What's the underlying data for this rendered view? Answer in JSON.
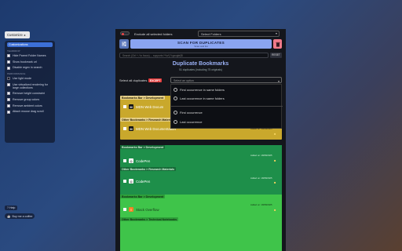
{
  "sidebar": {
    "customize_label": "Customize",
    "active_item": "Customizations",
    "sections": [
      {
        "title": "",
        "items": [
          {
            "label": "Hide Parent Folder Names",
            "checked": false
          },
          {
            "label": "Show bookmark url",
            "checked": false
          },
          {
            "label": "Disable regex in search",
            "checked": false
          }
        ]
      },
      {
        "title": "PERFORMANCE",
        "items": [
          {
            "label": "Use light mode",
            "checked": true
          },
          {
            "label": "Use virtualized rendering for large collections",
            "checked": false
          },
          {
            "label": "Remove height constraint",
            "checked": false
          },
          {
            "label": "Remove group colors",
            "checked": false
          },
          {
            "label": "Remove ambient colors",
            "checked": false
          },
          {
            "label": "Attach mouse drag scroll",
            "checked": false
          }
        ]
      }
    ],
    "section_title_1": "TEARDROP",
    "help_label": "? Help",
    "coffee_label": "Buy me a coffee"
  },
  "topbar": {
    "exclude_label": "Exclude all selected folders",
    "folder_placeholder": "Select Folders"
  },
  "scan": {
    "title": "SCAN FOR DUPLICATES",
    "subtitle": "Scan and list"
  },
  "search": {
    "placeholder": "Search (Ctrl + / to focus) ... supports /^\\\\s*(?i:google)$/",
    "reset_label": "RESET"
  },
  "header": {
    "title": "Duplicate Bookmarks",
    "subtitle": "51 duplicates (including 75 originals)"
  },
  "select_all": {
    "label": "Select all duplicates",
    "except": "EXCEPT",
    "placeholder": "Select an option"
  },
  "dropdown": {
    "options": [
      "First occurrence in same folders",
      "Last occurrence in same folders",
      "First occurrence",
      "Last occurrence"
    ]
  },
  "groups": [
    {
      "color": "#c9a82c",
      "entries": [
        {
          "path": "Bookmarks Bar > Development",
          "title": "MDN Web Docum",
          "added": "",
          "truncated": true
        },
        {
          "path": "Other Bookmarks > Research Materials",
          "title": "MDN Web Documentation",
          "added": "Added on: 18/08/2025"
        }
      ]
    },
    {
      "color": "#1e8f4a",
      "entries": [
        {
          "path": "Bookmarks Bar > Development",
          "title": "CodePen",
          "added": "Added on: 18/08/2025"
        },
        {
          "path": "Other Bookmarks > Research Materials",
          "title": "CodePen",
          "added": "Added on: 18/08/2025"
        }
      ]
    },
    {
      "color": "#3fc44a",
      "entries": [
        {
          "path": "Bookmarks Bar > Development",
          "title": "Stack Overflow",
          "added": "Added on: 18/08/2025"
        },
        {
          "path": "Other Bookmarks > Technical Notebooks",
          "title": "",
          "added": ""
        }
      ]
    }
  ],
  "colors": {
    "accent": "#8aa4f0",
    "danger": "#f07a8a",
    "group_yellow": "#c9a82c",
    "group_green": "#1e8f4a",
    "group_lime": "#3fc44a"
  }
}
